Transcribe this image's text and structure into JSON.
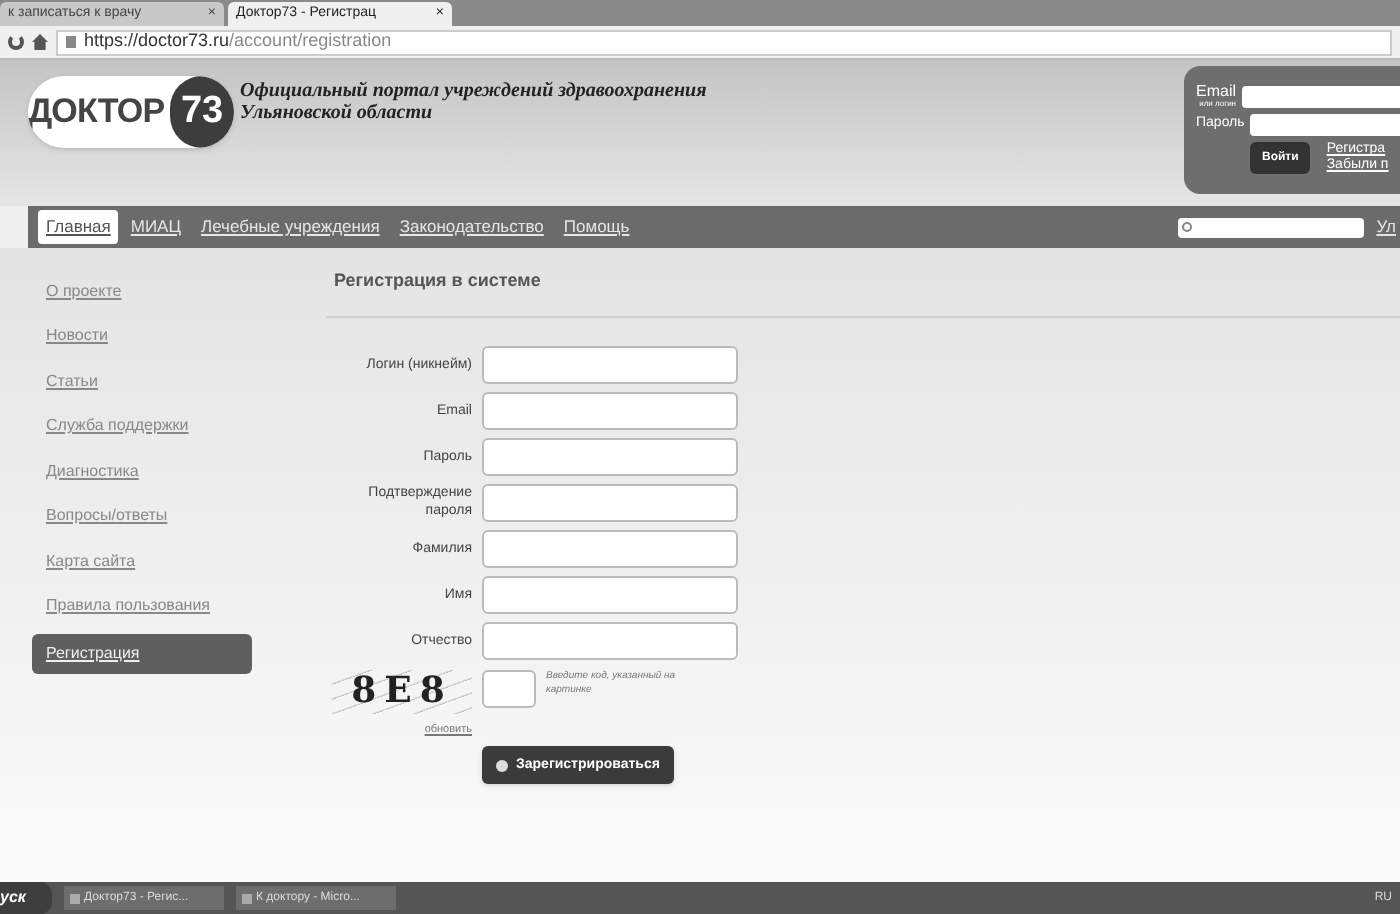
{
  "browser": {
    "tabs": [
      {
        "label": "к записаться к врачу",
        "close": "×",
        "selected": false
      },
      {
        "label": "Доктор73 - Регистрац",
        "close": "×",
        "selected": true
      }
    ],
    "url_host": "https://doctor73.ru",
    "url_path": "/account/registration"
  },
  "header": {
    "logo_word": "ДОКТОР",
    "logo_number": "73",
    "title": "Официальный портал учреждений здравоохранения",
    "subtitle": "Ульяновской области"
  },
  "login": {
    "email_label": "Email",
    "email_sublabel": "или логин",
    "password_label": "Пароль",
    "submit": "Войти",
    "links": [
      "Регистра",
      "Забыли п"
    ]
  },
  "nav": {
    "items": [
      {
        "label": "Главная",
        "selected": true
      },
      {
        "label": "МИАЦ",
        "selected": false
      },
      {
        "label": "Лечебные учреждения",
        "selected": false
      },
      {
        "label": "Законодательство",
        "selected": false
      },
      {
        "label": "Помощь",
        "selected": false
      }
    ],
    "right_link": "Ул"
  },
  "sidebar": {
    "items": [
      {
        "label": "О проекте",
        "selected": false
      },
      {
        "label": "Новости",
        "selected": false
      },
      {
        "label": "Статьи",
        "selected": false
      },
      {
        "label": "Служба поддержки",
        "selected": false
      },
      {
        "label": "Диагностика",
        "selected": false
      },
      {
        "label": "Вопросы/ответы",
        "selected": false
      },
      {
        "label": "Карта сайта",
        "selected": false
      },
      {
        "label": "Правила пользования",
        "selected": false
      },
      {
        "label": "Регистрация",
        "selected": true
      }
    ]
  },
  "form": {
    "title": "Регистрация в системе",
    "fields": [
      "Логин (никнейм)",
      "Email",
      "Пароль",
      "Подтверждение пароля",
      "Фамилия",
      "Имя",
      "Отчество"
    ],
    "captcha": "8E8",
    "captcha_hint": "Введите код, указанный на картинке",
    "refresh": "обновить",
    "submit": "Зарегистрироваться"
  },
  "taskbar": {
    "start": "уск",
    "items": [
      "Доктор73 - Регис...",
      "К доктору - Micro..."
    ],
    "language": "RU"
  }
}
